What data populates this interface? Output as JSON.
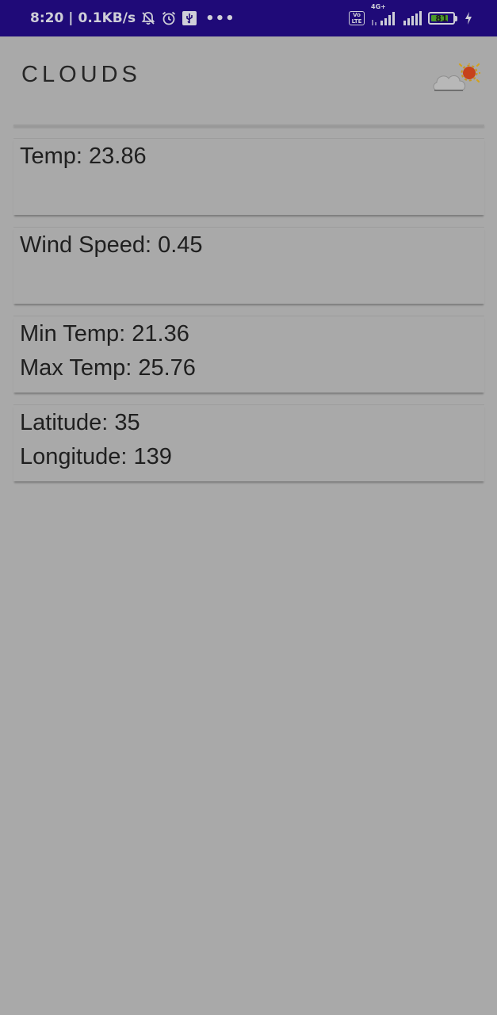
{
  "status_bar": {
    "time": "8:20",
    "speed": "0.1KB/s",
    "network": "4G+",
    "volte": "Vo LTE",
    "battery": "81",
    "battery_level": 0.81
  },
  "app_bar": {
    "title": "CLOUDS",
    "icon": "cloud-sun-icon"
  },
  "cards": {
    "temp": "Temp: 23.86",
    "wind": "Wind Speed: 0.45",
    "min_temp": "Min Temp: 21.36",
    "max_temp": "Max Temp: 25.76",
    "latitude": "Latitude: 35",
    "longitude": "Longitude: 139"
  },
  "colors": {
    "status_bar": "#1f0a78",
    "background": "#a9a9a9",
    "text": "#1f1f1f",
    "battery_fill": "#4a9a2a"
  }
}
